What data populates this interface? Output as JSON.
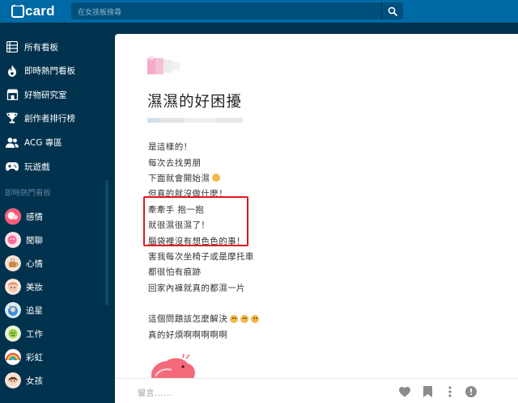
{
  "app": {
    "logo_text": "card"
  },
  "search": {
    "placeholder": "在女孩板搜尋",
    "icon": "search-icon"
  },
  "sidebar": {
    "items": [
      {
        "label": "所有看板",
        "icon": "list-icon"
      },
      {
        "label": "即時熱門看板",
        "icon": "flame-icon"
      },
      {
        "label": "好物研究室",
        "icon": "store-icon"
      },
      {
        "label": "創作者排行榜",
        "icon": "trophy-icon"
      },
      {
        "label": "ACG 專區",
        "icon": "users-icon"
      },
      {
        "label": "玩遊戲",
        "icon": "gamepad-icon"
      }
    ],
    "section_title": "即時熱門看板",
    "boards": [
      {
        "label": "感情",
        "color": "#ff5a7a"
      },
      {
        "label": "閒聊",
        "color": "#ff6b9a"
      },
      {
        "label": "心情",
        "color": "#c98a4a"
      },
      {
        "label": "美妝",
        "color": "#f5b8a0"
      },
      {
        "label": "追星",
        "color": "#3b8ee0"
      },
      {
        "label": "工作",
        "color": "#9ccf4b"
      },
      {
        "label": "彩虹",
        "color": "#e94b8a"
      },
      {
        "label": "女孩",
        "color": "#d9a07a"
      }
    ]
  },
  "post": {
    "title": "濕濕的好困擾",
    "lines": [
      "是這樣的！",
      "每次去找男朋",
      "下面就會開始濕",
      "但真的就沒做什麼！",
      "牽牽手 抱一抱",
      "就很濕很濕了！",
      "腦袋裡沒有想色色的事！",
      "害我每次坐椅子或是摩托車",
      "都很怕有痕跡",
      "回家內褲就真的都濕一片",
      "",
      "這個問題該怎麼解決",
      "真的好煩啊啊啊啊啊"
    ]
  },
  "footer": {
    "comment_placeholder": "留言......"
  },
  "colors": {
    "topbar": "#006aa6",
    "sidebar": "#00324e",
    "highlight": "#e3151c"
  }
}
